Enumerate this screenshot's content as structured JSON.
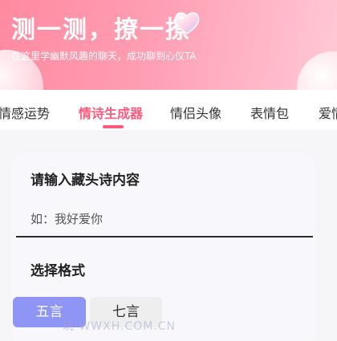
{
  "header": {
    "title": "测一测，撩一撩",
    "subtitle": "在这里学幽默风趣的聊天，成功聊到心仪TA",
    "title_icon": "heart-icon"
  },
  "tabs": [
    {
      "label": "情感运势",
      "active": false
    },
    {
      "label": "情诗生成器",
      "active": true
    },
    {
      "label": "情侣头像",
      "active": false
    },
    {
      "label": "表情包",
      "active": false
    },
    {
      "label": "爱情",
      "active": false
    }
  ],
  "form": {
    "input_section_label": "请输入藏头诗内容",
    "input_placeholder": "如：我好爱你",
    "input_value": "",
    "format_section_label": "选择格式",
    "format_options": [
      {
        "label": "五言",
        "selected": true
      },
      {
        "label": "七言",
        "selected": false
      }
    ]
  },
  "watermark": "玩·WWXH.COM.CN",
  "colors": {
    "accent": "#ff5a7e",
    "hero_gradient_start": "#ff8aa0",
    "hero_gradient_end": "#ffc9d6",
    "selected_button": "#8f95f5"
  }
}
